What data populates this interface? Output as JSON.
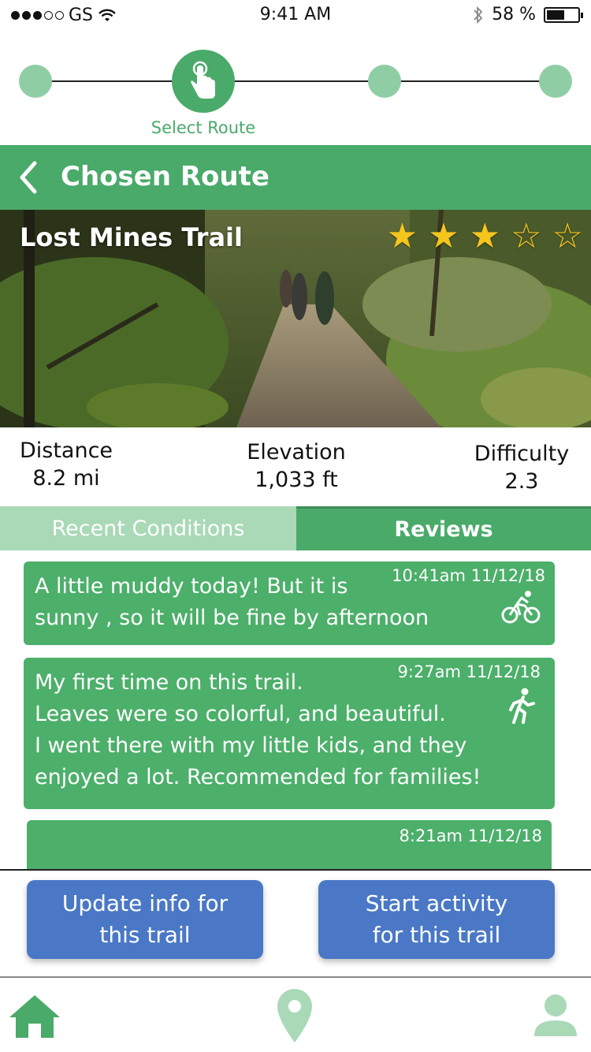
{
  "status_bar": {
    "carrier": "GS",
    "time": "9:41 AM",
    "battery_percent": "58 %",
    "battery_level": 0.58
  },
  "stepper": {
    "active_label": "Select Route",
    "total_steps": 4,
    "active_step": 2
  },
  "header": {
    "title": "Chosen Route",
    "back_icon": "chevron-left-icon"
  },
  "trail": {
    "name": "Lost Mines Trail",
    "rating": 3,
    "rating_max": 5
  },
  "stats": {
    "distance": {
      "label": "Distance",
      "value": "8.2 mi"
    },
    "elevation": {
      "label": "Elevation",
      "value": "1,033 ft"
    },
    "difficulty": {
      "label": "Difficulty",
      "value": "2.3"
    }
  },
  "tabs": {
    "conditions": "Recent Conditions",
    "reviews": "Reviews",
    "selected": "reviews"
  },
  "reviews": [
    {
      "text": "A little muddy today!  But it is\nsunny , so it will be fine by afternoon",
      "time": "10:41am 11/12/18",
      "icon": "bicycle-icon"
    },
    {
      "text": "My first time on this trail.\nLeaves were so colorful, and beautiful.\nI went there with my little kids, and they\nenjoyed a lot. Recommended for families!",
      "time": "9:27am 11/12/18",
      "icon": "hiker-icon"
    },
    {
      "text": "",
      "time": "8:21am 11/12/18",
      "icon": ""
    }
  ],
  "actions": {
    "update": "Update info for\nthis trail",
    "start": "Start activity\nfor this trail"
  },
  "nav": {
    "home_icon": "home-icon",
    "map_icon": "map-pin-icon",
    "profile_icon": "profile-icon"
  },
  "colors": {
    "primary_green": "#4aaa6a",
    "light_green": "#a9d9b7",
    "button_blue": "#4a78c6",
    "star_gold": "#f5c51c"
  }
}
